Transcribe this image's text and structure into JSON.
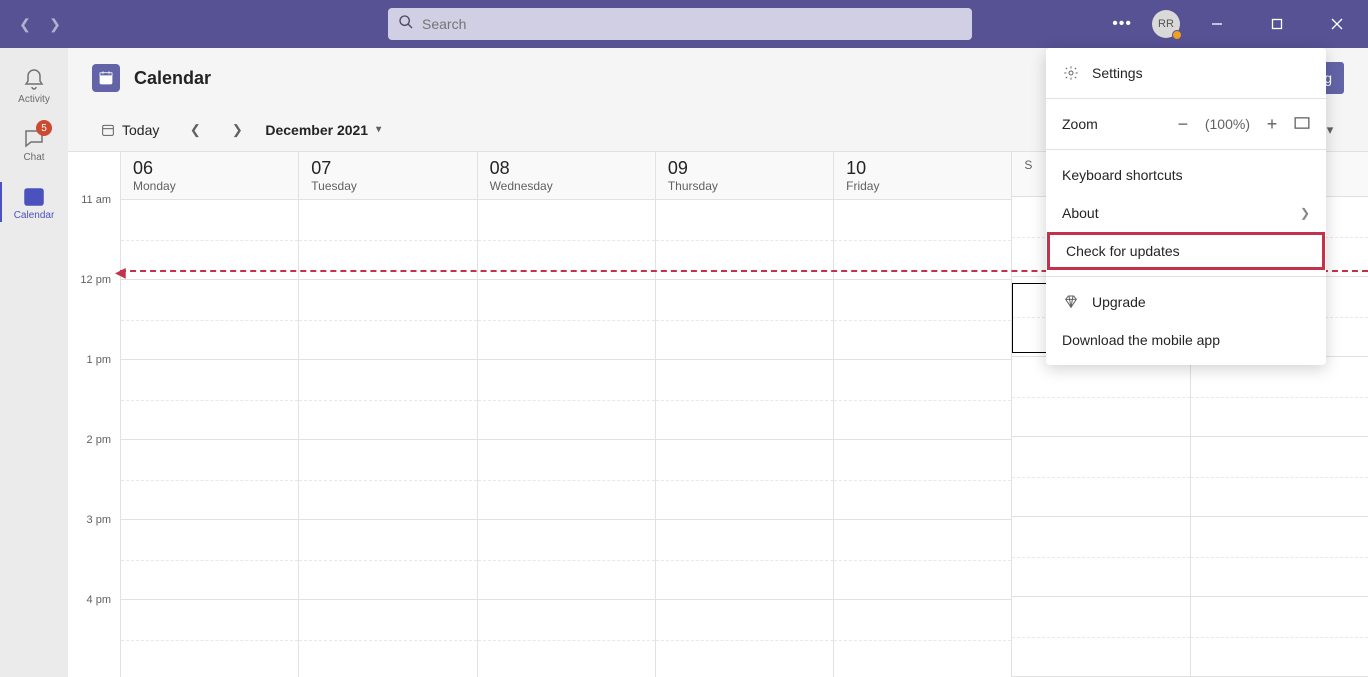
{
  "titlebar": {
    "search_placeholder": "Search",
    "avatar_initials": "RR"
  },
  "rail": {
    "items": [
      {
        "label": "Activity",
        "icon": "bell"
      },
      {
        "label": "Chat",
        "icon": "chat",
        "badge": "5"
      },
      {
        "label": "Calendar",
        "icon": "calendar",
        "active": true
      }
    ]
  },
  "header": {
    "title": "Calendar",
    "new_meeting_label": "ng"
  },
  "toolbar": {
    "today_label": "Today",
    "month_label": "December 2021"
  },
  "calendar": {
    "times": [
      "11 am",
      "12 pm",
      "1 pm",
      "2 pm",
      "3 pm",
      "4 pm"
    ],
    "days": [
      {
        "num": "06",
        "name": "Monday"
      },
      {
        "num": "07",
        "name": "Tuesday"
      },
      {
        "num": "08",
        "name": "Wednesday"
      },
      {
        "num": "09",
        "name": "Thursday"
      },
      {
        "num": "10",
        "name": "Friday"
      },
      {
        "num": "",
        "name": "S"
      },
      {
        "num": "",
        "name": ""
      }
    ]
  },
  "menu": {
    "settings": "Settings",
    "zoom_label": "Zoom",
    "zoom_value": "(100%)",
    "keyboard": "Keyboard shortcuts",
    "about": "About",
    "check_updates": "Check for updates",
    "upgrade": "Upgrade",
    "download_mobile": "Download the mobile app"
  }
}
